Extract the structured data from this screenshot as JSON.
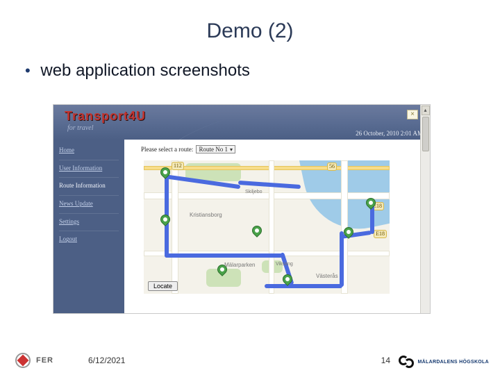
{
  "slide": {
    "title": "Demo (2)",
    "bullet": "web application screenshots"
  },
  "app": {
    "brand": "Transport4U",
    "tagline": "for travel",
    "datetime": "26 October, 2010 2:01 AM",
    "sidebar": [
      {
        "label": "Home"
      },
      {
        "label": "User Information"
      },
      {
        "label": "Route Information"
      },
      {
        "label": "News Update"
      },
      {
        "label": "Settings"
      },
      {
        "label": "Logout"
      }
    ],
    "route_prompt": "Please select a route:",
    "route_selected": "Route No 1",
    "locate_btn": "Locate",
    "map": {
      "city_labels": [
        "Kristiansborg",
        "Västerås",
        "Mälarparken",
        "Viksäng",
        "Skiljebo"
      ],
      "shields": [
        "112",
        "56",
        "E18",
        "E18"
      ]
    }
  },
  "footer": {
    "fer": "FER",
    "date": "6/12/2021",
    "page": "14",
    "mdh": "MÄLARDALENS HÖGSKOLA"
  }
}
